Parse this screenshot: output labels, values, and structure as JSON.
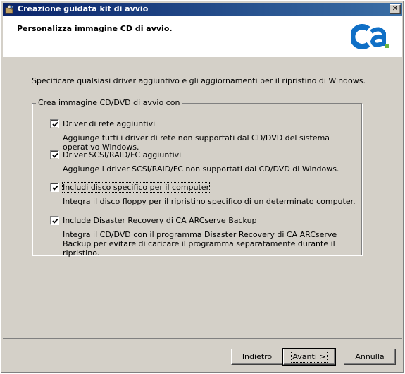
{
  "window": {
    "title": "Creazione guidata kit di avvio",
    "close_glyph": "✕"
  },
  "header": {
    "title": "Personalizza immagine CD di avvio.",
    "logo_icon": "ca-logo",
    "logo_colors": {
      "blue": "#0f6fc6",
      "green": "#6cb33e"
    }
  },
  "intro_text": "Specificare qualsiasi driver aggiuntivo e gli aggiornamenti  per il ripristino di Windows.",
  "group": {
    "legend": "Crea immagine CD/DVD di avvio con",
    "options": [
      {
        "label": "Driver di rete aggiuntivi",
        "checked": true,
        "description": "Aggiunge tutti i driver di rete non supportati dal CD/DVD del sistema operativo Windows."
      },
      {
        "label": "Driver SCSI/RAID/FC aggiuntivi",
        "checked": true,
        "description": "Aggiunge i driver SCSI/RAID/FC non supportati dal CD/DVD di Windows."
      },
      {
        "label": "Includi disco specifico per il computer",
        "checked": true,
        "description": "Integra il disco floppy per il ripristino specifico di un determinato computer."
      },
      {
        "label": "Include Disaster Recovery di CA ARCserve Backup",
        "checked": true,
        "description": "Integra il CD/DVD con il programma Disaster Recovery di CA ARCserve Backup per evitare di caricare il programma separatamente durante il ripristino."
      }
    ]
  },
  "buttons": {
    "back": "Indietro",
    "next": "Avanti >",
    "cancel": "Annulla"
  }
}
